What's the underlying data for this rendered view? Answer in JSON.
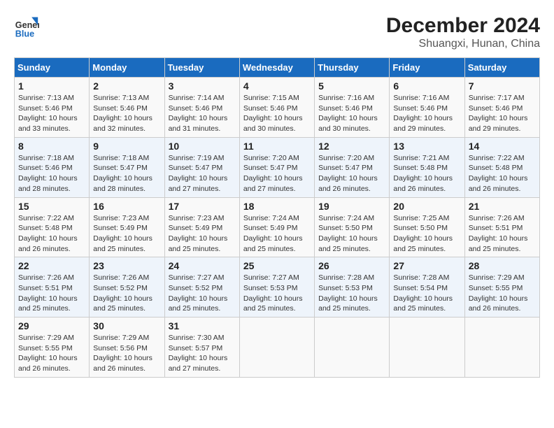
{
  "header": {
    "logo_line1": "General",
    "logo_line2": "Blue",
    "title": "December 2024",
    "subtitle": "Shuangxi, Hunan, China"
  },
  "weekdays": [
    "Sunday",
    "Monday",
    "Tuesday",
    "Wednesday",
    "Thursday",
    "Friday",
    "Saturday"
  ],
  "weeks": [
    [
      {
        "day": "1",
        "info": "Sunrise: 7:13 AM\nSunset: 5:46 PM\nDaylight: 10 hours\nand 33 minutes."
      },
      {
        "day": "2",
        "info": "Sunrise: 7:13 AM\nSunset: 5:46 PM\nDaylight: 10 hours\nand 32 minutes."
      },
      {
        "day": "3",
        "info": "Sunrise: 7:14 AM\nSunset: 5:46 PM\nDaylight: 10 hours\nand 31 minutes."
      },
      {
        "day": "4",
        "info": "Sunrise: 7:15 AM\nSunset: 5:46 PM\nDaylight: 10 hours\nand 30 minutes."
      },
      {
        "day": "5",
        "info": "Sunrise: 7:16 AM\nSunset: 5:46 PM\nDaylight: 10 hours\nand 30 minutes."
      },
      {
        "day": "6",
        "info": "Sunrise: 7:16 AM\nSunset: 5:46 PM\nDaylight: 10 hours\nand 29 minutes."
      },
      {
        "day": "7",
        "info": "Sunrise: 7:17 AM\nSunset: 5:46 PM\nDaylight: 10 hours\nand 29 minutes."
      }
    ],
    [
      {
        "day": "8",
        "info": "Sunrise: 7:18 AM\nSunset: 5:46 PM\nDaylight: 10 hours\nand 28 minutes."
      },
      {
        "day": "9",
        "info": "Sunrise: 7:18 AM\nSunset: 5:47 PM\nDaylight: 10 hours\nand 28 minutes."
      },
      {
        "day": "10",
        "info": "Sunrise: 7:19 AM\nSunset: 5:47 PM\nDaylight: 10 hours\nand 27 minutes."
      },
      {
        "day": "11",
        "info": "Sunrise: 7:20 AM\nSunset: 5:47 PM\nDaylight: 10 hours\nand 27 minutes."
      },
      {
        "day": "12",
        "info": "Sunrise: 7:20 AM\nSunset: 5:47 PM\nDaylight: 10 hours\nand 26 minutes."
      },
      {
        "day": "13",
        "info": "Sunrise: 7:21 AM\nSunset: 5:48 PM\nDaylight: 10 hours\nand 26 minutes."
      },
      {
        "day": "14",
        "info": "Sunrise: 7:22 AM\nSunset: 5:48 PM\nDaylight: 10 hours\nand 26 minutes."
      }
    ],
    [
      {
        "day": "15",
        "info": "Sunrise: 7:22 AM\nSunset: 5:48 PM\nDaylight: 10 hours\nand 26 minutes."
      },
      {
        "day": "16",
        "info": "Sunrise: 7:23 AM\nSunset: 5:49 PM\nDaylight: 10 hours\nand 25 minutes."
      },
      {
        "day": "17",
        "info": "Sunrise: 7:23 AM\nSunset: 5:49 PM\nDaylight: 10 hours\nand 25 minutes."
      },
      {
        "day": "18",
        "info": "Sunrise: 7:24 AM\nSunset: 5:49 PM\nDaylight: 10 hours\nand 25 minutes."
      },
      {
        "day": "19",
        "info": "Sunrise: 7:24 AM\nSunset: 5:50 PM\nDaylight: 10 hours\nand 25 minutes."
      },
      {
        "day": "20",
        "info": "Sunrise: 7:25 AM\nSunset: 5:50 PM\nDaylight: 10 hours\nand 25 minutes."
      },
      {
        "day": "21",
        "info": "Sunrise: 7:26 AM\nSunset: 5:51 PM\nDaylight: 10 hours\nand 25 minutes."
      }
    ],
    [
      {
        "day": "22",
        "info": "Sunrise: 7:26 AM\nSunset: 5:51 PM\nDaylight: 10 hours\nand 25 minutes."
      },
      {
        "day": "23",
        "info": "Sunrise: 7:26 AM\nSunset: 5:52 PM\nDaylight: 10 hours\nand 25 minutes."
      },
      {
        "day": "24",
        "info": "Sunrise: 7:27 AM\nSunset: 5:52 PM\nDaylight: 10 hours\nand 25 minutes."
      },
      {
        "day": "25",
        "info": "Sunrise: 7:27 AM\nSunset: 5:53 PM\nDaylight: 10 hours\nand 25 minutes."
      },
      {
        "day": "26",
        "info": "Sunrise: 7:28 AM\nSunset: 5:53 PM\nDaylight: 10 hours\nand 25 minutes."
      },
      {
        "day": "27",
        "info": "Sunrise: 7:28 AM\nSunset: 5:54 PM\nDaylight: 10 hours\nand 25 minutes."
      },
      {
        "day": "28",
        "info": "Sunrise: 7:29 AM\nSunset: 5:55 PM\nDaylight: 10 hours\nand 26 minutes."
      }
    ],
    [
      {
        "day": "29",
        "info": "Sunrise: 7:29 AM\nSunset: 5:55 PM\nDaylight: 10 hours\nand 26 minutes."
      },
      {
        "day": "30",
        "info": "Sunrise: 7:29 AM\nSunset: 5:56 PM\nDaylight: 10 hours\nand 26 minutes."
      },
      {
        "day": "31",
        "info": "Sunrise: 7:30 AM\nSunset: 5:57 PM\nDaylight: 10 hours\nand 27 minutes."
      },
      {
        "day": "",
        "info": ""
      },
      {
        "day": "",
        "info": ""
      },
      {
        "day": "",
        "info": ""
      },
      {
        "day": "",
        "info": ""
      }
    ]
  ]
}
